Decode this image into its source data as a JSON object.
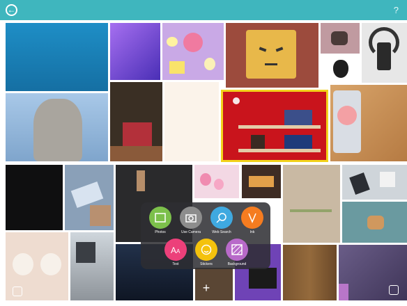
{
  "header": {
    "back_icon": "back-arrow-circle-icon",
    "help_label": "?"
  },
  "picker_menu": {
    "items": [
      {
        "label": "Photos",
        "icon": "photo-icon",
        "color": "#7cc04b"
      },
      {
        "label": "Use Camera",
        "icon": "camera-icon",
        "color": "#8d8d8d"
      },
      {
        "label": "Web Search",
        "icon": "search-icon",
        "color": "#3fa9e0"
      },
      {
        "label": "Ink",
        "icon": "ink-pen-icon",
        "color": "#f57c20"
      },
      {
        "label": "Text",
        "icon": "text-icon",
        "color": "#ec407a"
      },
      {
        "label": "Stickers",
        "icon": "smiley-icon",
        "color": "#f4c20d"
      },
      {
        "label": "Background",
        "icon": "pattern-icon",
        "color": "#b86ac9"
      }
    ],
    "add_label": "+"
  },
  "colors": {
    "header": "#3fb6be",
    "selection_border": "#f2d21b"
  }
}
